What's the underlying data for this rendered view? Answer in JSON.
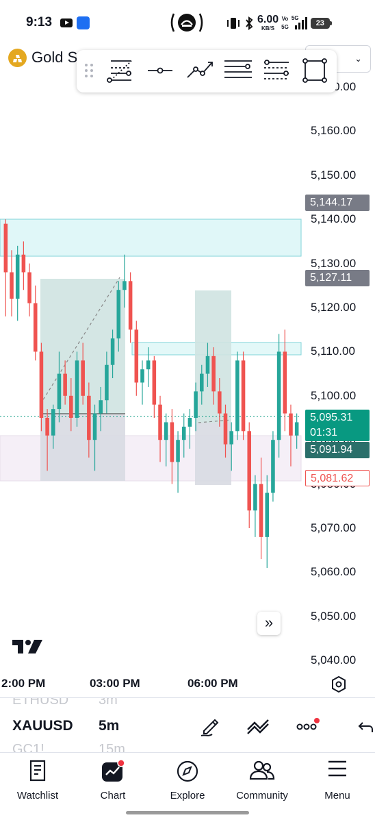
{
  "status_bar": {
    "time": "9:13",
    "net_speed": "6.00",
    "net_unit": "KB/S",
    "vo": "Vo",
    "band": "5G",
    "net_type": "5G",
    "battery": "23"
  },
  "header": {
    "title": "Gold S",
    "timeframe_icon": "chevron-down-icon"
  },
  "drawing_toolbar": {
    "tools": [
      "drag-handle-icon",
      "fib-retracement-icon",
      "horizontal-ray-icon",
      "path-icon",
      "parallel-channel-icon",
      "fib-channel-icon",
      "rectangle-icon"
    ]
  },
  "chart": {
    "price_axis": [
      "5,170.00",
      "5,160.00",
      "5,150.00",
      "5,140.00",
      "5,130.00",
      "5,120.00",
      "5,110.00",
      "5,100.00",
      "5,090.00",
      "5,080.00",
      "5,070.00",
      "5,060.00",
      "5,050.00",
      "5,040.00"
    ],
    "labels": {
      "level_high": "5,144.17",
      "level_mid": "5,127.11",
      "last_price": "5,095.31",
      "countdown": "01:31",
      "level_bid": "5,091.94",
      "level_low": "5,081.62"
    },
    "time_axis": [
      "2:00 PM",
      "03:00 PM",
      "06:00 PM"
    ],
    "colors": {
      "up": "#26a69a",
      "down": "#ef5350",
      "last_price": "#089981",
      "neutral_label": "#787b86",
      "bid_label": "#2a6f6a",
      "zone_cyan": "#e0f7f8",
      "zone_pink": "#f4eef6"
    }
  },
  "chart_data": {
    "type": "candlestick",
    "ylim": [
      5040,
      5170
    ],
    "levels": {
      "high": 5144.17,
      "mid": 5127.11,
      "last": 5095.31,
      "bid": 5091.94,
      "low": 5081.62
    },
    "candles": [
      [
        5139,
        5140,
        5118,
        5128
      ],
      [
        5128,
        5133,
        5118,
        5122
      ],
      [
        5122,
        5134,
        5117,
        5132
      ],
      [
        5132,
        5135,
        5124,
        5128
      ],
      [
        5128,
        5130,
        5118,
        5121
      ],
      [
        5121,
        5125,
        5108,
        5110
      ],
      [
        5110,
        5112,
        5092,
        5095
      ],
      [
        5095,
        5097,
        5083,
        5091
      ],
      [
        5091,
        5098,
        5088,
        5097
      ],
      [
        5097,
        5110,
        5094,
        5105
      ],
      [
        5105,
        5108,
        5098,
        5100
      ],
      [
        5100,
        5104,
        5092,
        5095
      ],
      [
        5095,
        5110,
        5093,
        5108
      ],
      [
        5108,
        5112,
        5098,
        5100
      ],
      [
        5100,
        5103,
        5086,
        5090
      ],
      [
        5090,
        5098,
        5083,
        5096
      ],
      [
        5096,
        5102,
        5092,
        5099
      ],
      [
        5099,
        5110,
        5096,
        5107
      ],
      [
        5107,
        5115,
        5104,
        5113
      ],
      [
        5113,
        5126,
        5110,
        5124
      ],
      [
        5124,
        5132,
        5120,
        5126
      ],
      [
        5126,
        5128,
        5112,
        5115
      ],
      [
        5115,
        5117,
        5100,
        5103
      ],
      [
        5103,
        5108,
        5098,
        5106
      ],
      [
        5106,
        5111,
        5102,
        5108
      ],
      [
        5108,
        5109,
        5095,
        5098
      ],
      [
        5098,
        5100,
        5085,
        5090
      ],
      [
        5090,
        5096,
        5084,
        5094
      ],
      [
        5094,
        5097,
        5080,
        5085
      ],
      [
        5085,
        5092,
        5078,
        5090
      ],
      [
        5090,
        5096,
        5086,
        5093
      ],
      [
        5093,
        5097,
        5088,
        5095
      ],
      [
        5095,
        5103,
        5092,
        5101
      ],
      [
        5101,
        5107,
        5098,
        5105
      ],
      [
        5105,
        5112,
        5102,
        5109
      ],
      [
        5109,
        5111,
        5098,
        5101
      ],
      [
        5101,
        5104,
        5093,
        5096
      ],
      [
        5096,
        5098,
        5086,
        5089
      ],
      [
        5089,
        5094,
        5083,
        5092
      ],
      [
        5092,
        5110,
        5090,
        5108
      ],
      [
        5108,
        5110,
        5090,
        5092
      ],
      [
        5092,
        5094,
        5070,
        5074
      ],
      [
        5074,
        5082,
        5068,
        5080
      ],
      [
        5080,
        5086,
        5063,
        5068
      ],
      [
        5068,
        5082,
        5061,
        5078
      ],
      [
        5078,
        5092,
        5076,
        5090
      ],
      [
        5090,
        5114,
        5086,
        5110
      ],
      [
        5110,
        5115,
        5092,
        5096
      ],
      [
        5096,
        5098,
        5084,
        5091
      ],
      [
        5091,
        5096,
        5088,
        5094
      ]
    ]
  },
  "symbol_bar": {
    "prev_symbol": "ETHUSD",
    "prev_interval": "3m",
    "symbol": "XAUUSD",
    "interval": "5m",
    "next_symbol": "GC1!",
    "next_interval": "15m"
  },
  "tabs": [
    {
      "label": "Watchlist",
      "icon": "watchlist-icon"
    },
    {
      "label": "Chart",
      "icon": "chart-icon"
    },
    {
      "label": "Explore",
      "icon": "compass-icon"
    },
    {
      "label": "Community",
      "icon": "community-icon"
    },
    {
      "label": "Menu",
      "icon": "menu-icon"
    }
  ]
}
